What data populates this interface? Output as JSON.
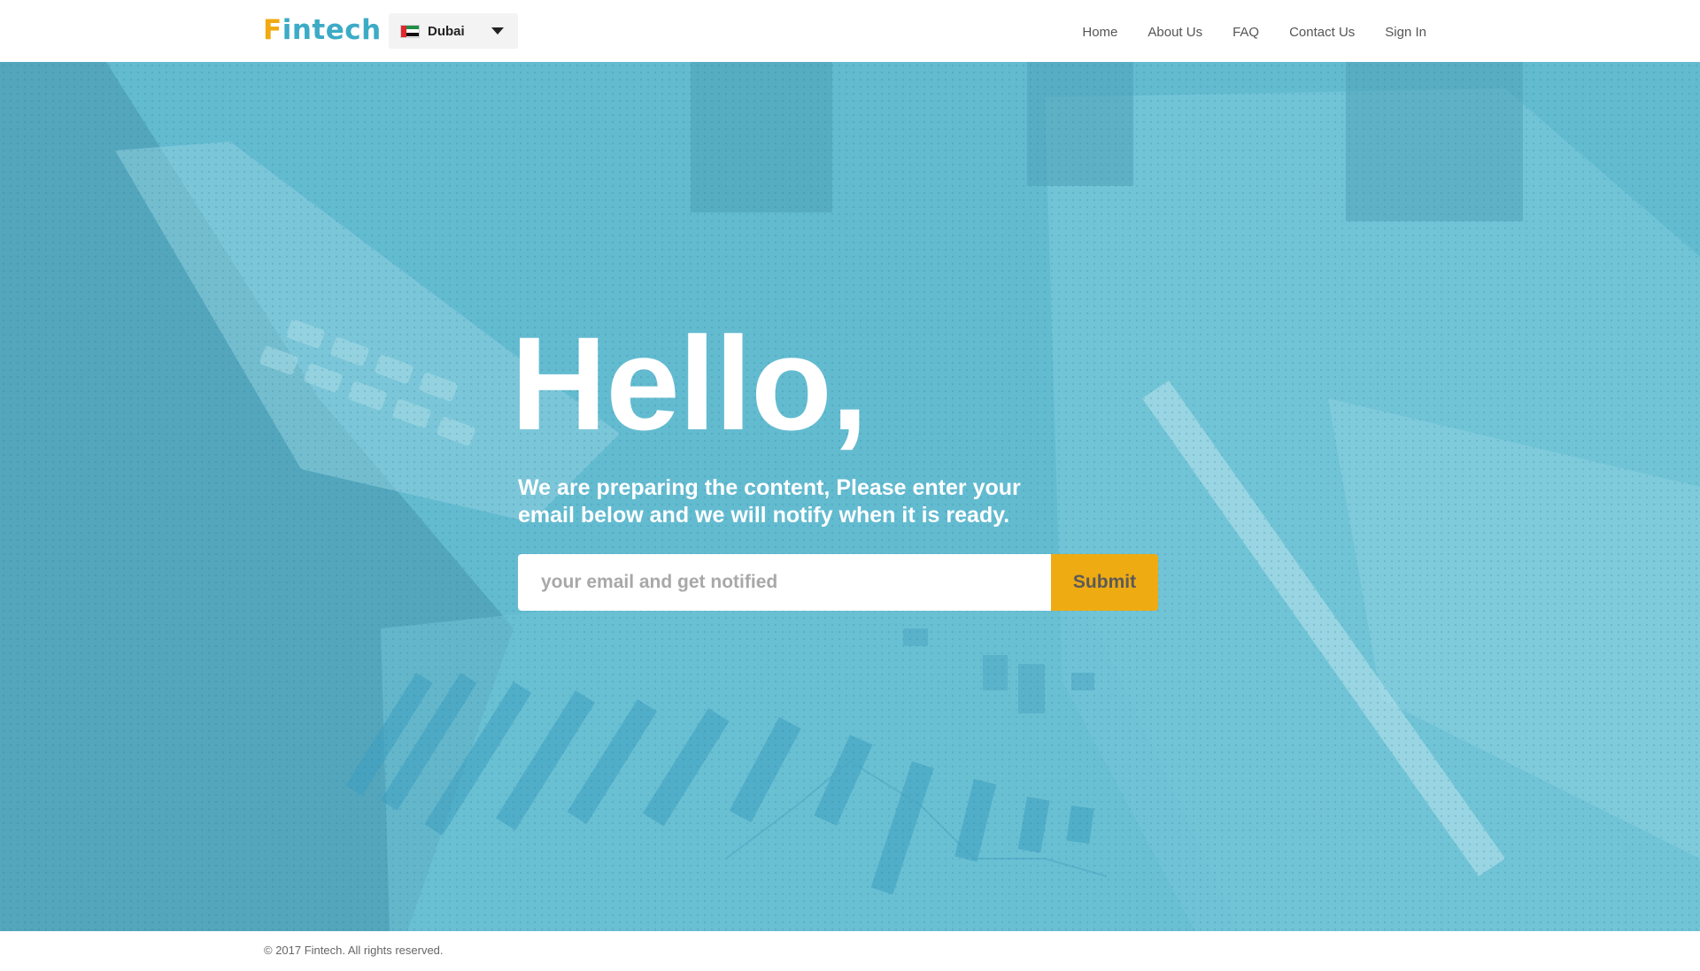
{
  "header": {
    "logo": {
      "first_letter": "F",
      "rest": "intech"
    },
    "city_selector": {
      "value": "Dubai",
      "flag": "uae-flag-icon"
    },
    "nav": [
      {
        "label": "Home"
      },
      {
        "label": "About Us"
      },
      {
        "label": "FAQ"
      },
      {
        "label": "Contact Us"
      },
      {
        "label": "Sign In"
      }
    ]
  },
  "hero": {
    "heading": "Hello,",
    "subtitle": "We are preparing the content, Please enter your email below and we will notify when it is ready.",
    "email_placeholder": "your email and get notified",
    "submit_label": "Submit"
  },
  "footer": {
    "copyright": "© 2017 Fintech. All rights reserved."
  },
  "colors": {
    "brand_teal": "#3cabc6",
    "brand_orange": "#f1aa12",
    "hero_overlay": "#63bbd0",
    "submit_bg": "#efab12"
  }
}
